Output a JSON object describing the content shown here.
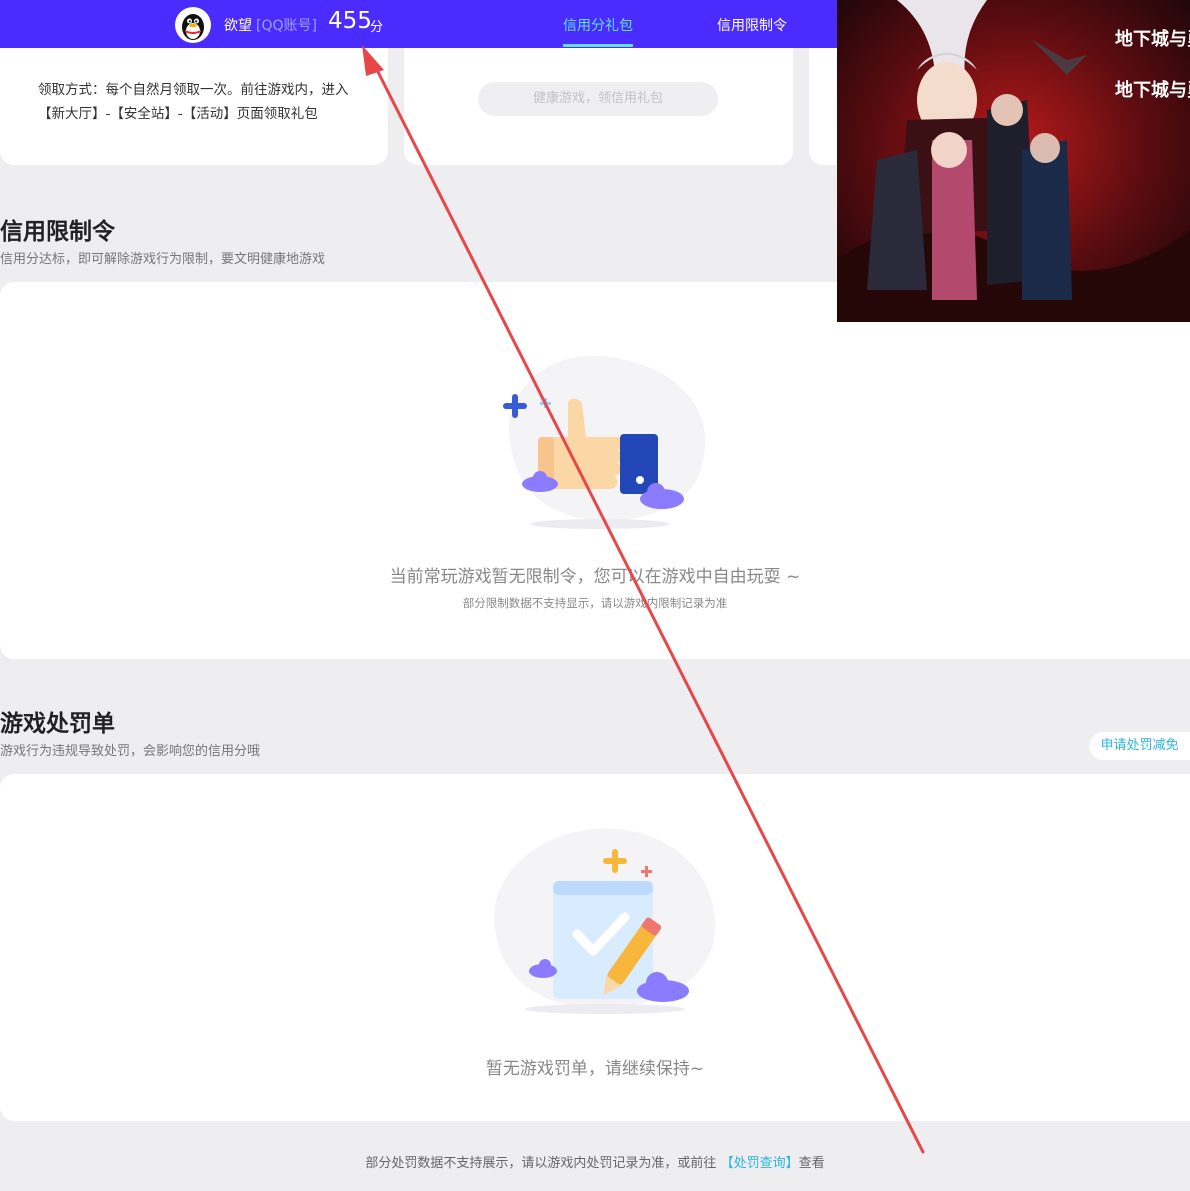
{
  "header": {
    "user_name": "欲望",
    "account_type": "[QQ账号]",
    "score_value": "455",
    "score_unit": "分",
    "tabs": [
      {
        "label": "信用分礼包",
        "active": true
      },
      {
        "label": "信用限制令",
        "active": false
      }
    ]
  },
  "gift_card": {
    "description": "领取方式：每个自然月领取一次。前往游戏内，进入【新大厅】-【安全站】-【活动】页面领取礼包",
    "button_label": "健康游戏，领信用礼包"
  },
  "restriction": {
    "title": "信用限制令",
    "desc": "信用分达标，即可解除游戏行为限制，要文明健康地游戏",
    "empty_main": "当前常玩游戏暂无限制令，您可以在游戏中自由玩耍 ~",
    "empty_sub": "部分限制数据不支持显示，请以游戏内限制记录为准"
  },
  "penalty": {
    "title": "游戏处罚单",
    "desc": "游戏行为违规导致处罚，会影响您的信用分哦",
    "apply_label": "申请处罚减免",
    "empty_main": "暂无游戏罚单，请继续保持~"
  },
  "footer": {
    "note_prefix": "部分处罚数据不支持展示，请以游戏内处罚记录为准，或前往",
    "link_label": "【处罚查询】",
    "note_suffix": "查看"
  },
  "banner": {
    "logo_text_1": "地下城与勇士",
    "logo_text_2": "地下城与勇士"
  },
  "colors": {
    "header_bg": "#4b2cff",
    "accent": "#5fe0ff",
    "link": "#2bb5e0",
    "annotation_arrow": "#e8474a"
  }
}
